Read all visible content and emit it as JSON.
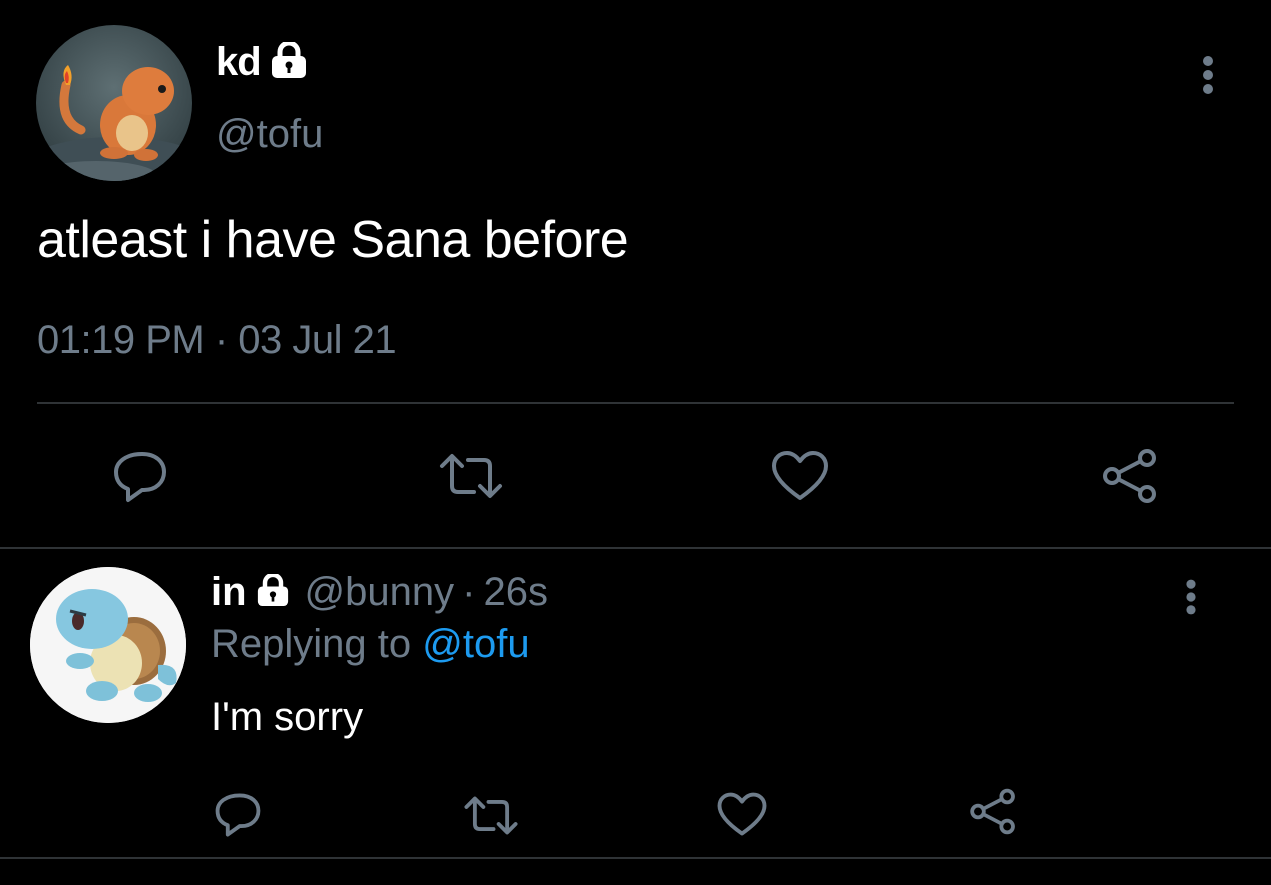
{
  "main_tweet": {
    "display_name": "kd",
    "handle": "@tofu",
    "text": "atleast i have Sana before",
    "time": "01:19 PM",
    "separator": "·",
    "date": "03 Jul 21",
    "avatar": "charmander-avatar",
    "protected_icon": "lock-icon"
  },
  "reply": {
    "display_name": "in",
    "handle": "@bunny",
    "separator": "·",
    "time_ago": "26s",
    "replying_prefix": "Replying to",
    "replying_to": "@tofu",
    "text": "I'm sorry",
    "avatar": "squirtle-avatar",
    "protected_icon": "lock-icon"
  },
  "actions": [
    "reply-icon",
    "retweet-icon",
    "like-icon",
    "share-icon"
  ],
  "colors": {
    "background": "#000000",
    "text": "#ffffff",
    "muted": "#6e7c8a",
    "link": "#1d9bf0",
    "divider": "#2f3336"
  }
}
